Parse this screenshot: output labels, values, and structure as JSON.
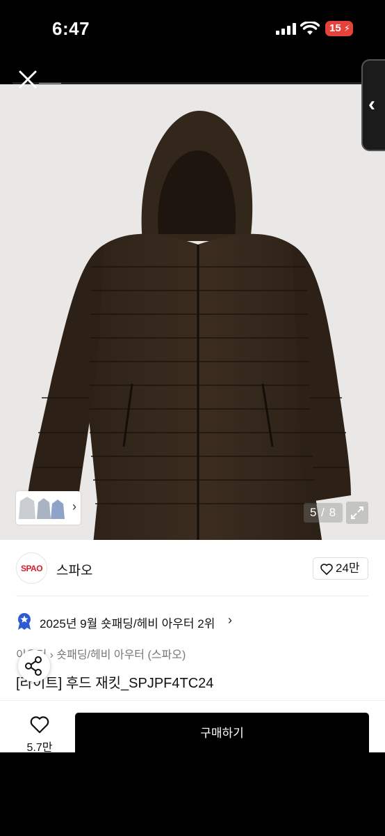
{
  "status_bar": {
    "time": "6:47",
    "battery": "15",
    "battery_color": "#e5423a"
  },
  "gallery": {
    "counter": "5 / 8",
    "icons": [
      "close-icon",
      "chevron-left-icon",
      "chevron-right-icon",
      "expand-icon",
      "share-icon"
    ]
  },
  "brand": {
    "logo_text": "SPAO",
    "name": "스파오",
    "logo_color": "#d21d2b"
  },
  "likes": {
    "count": "24만"
  },
  "ranking": {
    "text": "2025년 9월 숏패딩/헤비 아우터 2위",
    "chevron": "›"
  },
  "breadcrumb": {
    "text": "이우터 › 숏패딩/헤비 아우터 (스파오)"
  },
  "product": {
    "title": "[라이트] 후드 재킷_SPJPF4TC24"
  },
  "bottom_bar": {
    "wish_count": "5.7만",
    "buy_label": "구매하기"
  }
}
